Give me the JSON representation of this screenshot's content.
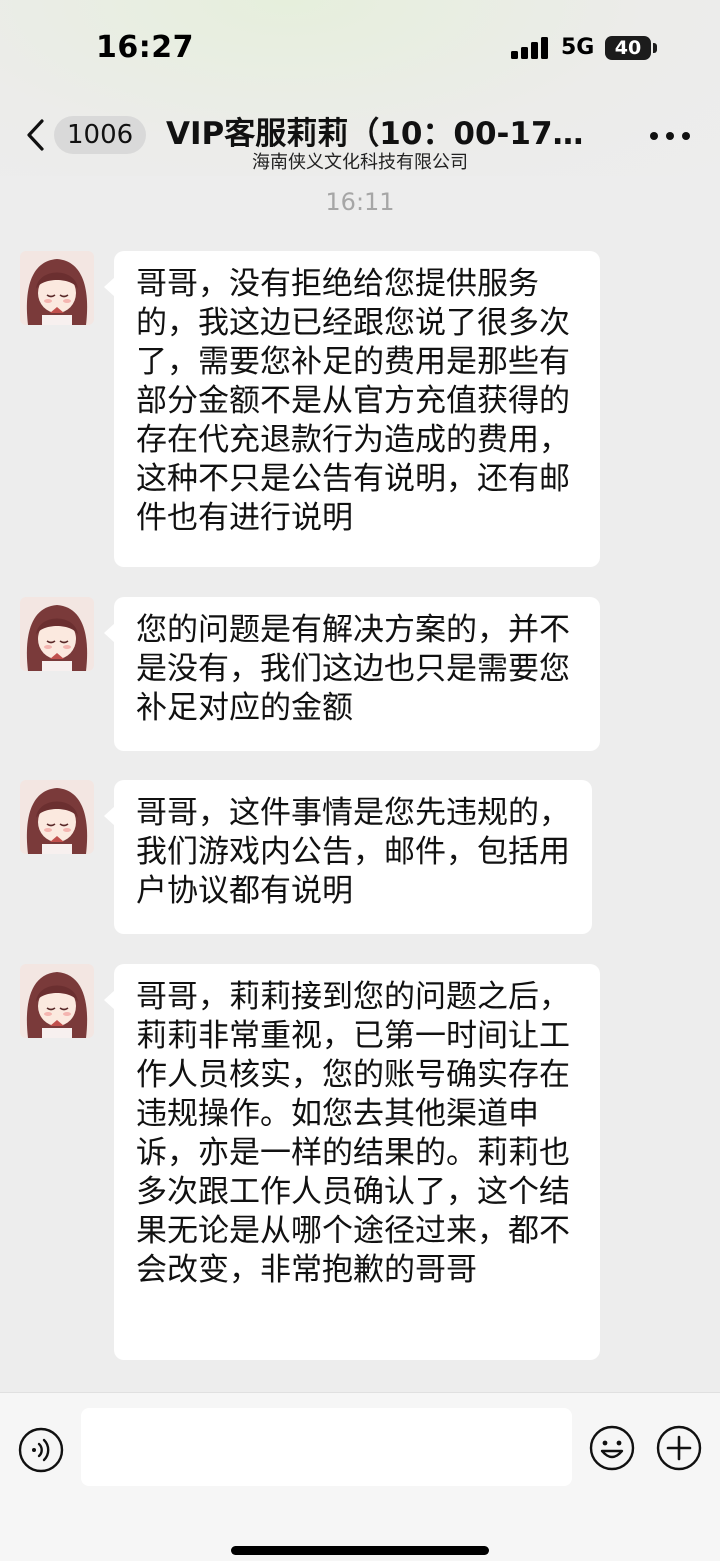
{
  "status_bar": {
    "time": "16:27",
    "network": "5G",
    "battery": "40"
  },
  "nav": {
    "back_count": "1006",
    "title": "VIP客服莉莉（10：00-17…",
    "subtitle": "海南侠义文化科技有限公司"
  },
  "chat": {
    "timestamp": "16:11",
    "messages": [
      {
        "sender": "received",
        "text": "哥哥，没有拒绝给您提供服务的，我这边已经跟您说了很多次了，需要您补足的费用是那些有部分金额不是从官方充值获得的存在代充退款行为造成的费用，这种不只是公告有说明，还有邮件也有进行说明"
      },
      {
        "sender": "received",
        "text": "您的问题是有解决方案的，并不是没有，我们这边也只是需要您补足对应的金额"
      },
      {
        "sender": "received",
        "text": "哥哥，这件事情是您先违规的，我们游戏内公告，邮件，包括用户协议都有说明"
      },
      {
        "sender": "received",
        "text": "哥哥，莉莉接到您的问题之后，莉莉非常重视，已第一时间让工作人员核实，您的账号确实存在违规操作。如您去其他渠道申诉，亦是一样的结果的。莉莉也多次跟工作人员确认了，这个结果无论是从哪个途径过来，都不会改变，非常抱歉的哥哥"
      }
    ]
  },
  "input_bar": {
    "value": "",
    "placeholder": ""
  },
  "icons": {
    "back": "chevron-left-icon",
    "more": "more-dots-icon",
    "voice": "voice-icon",
    "emoji": "emoji-icon",
    "plus": "plus-icon",
    "avatar": "anime-girl-avatar"
  }
}
